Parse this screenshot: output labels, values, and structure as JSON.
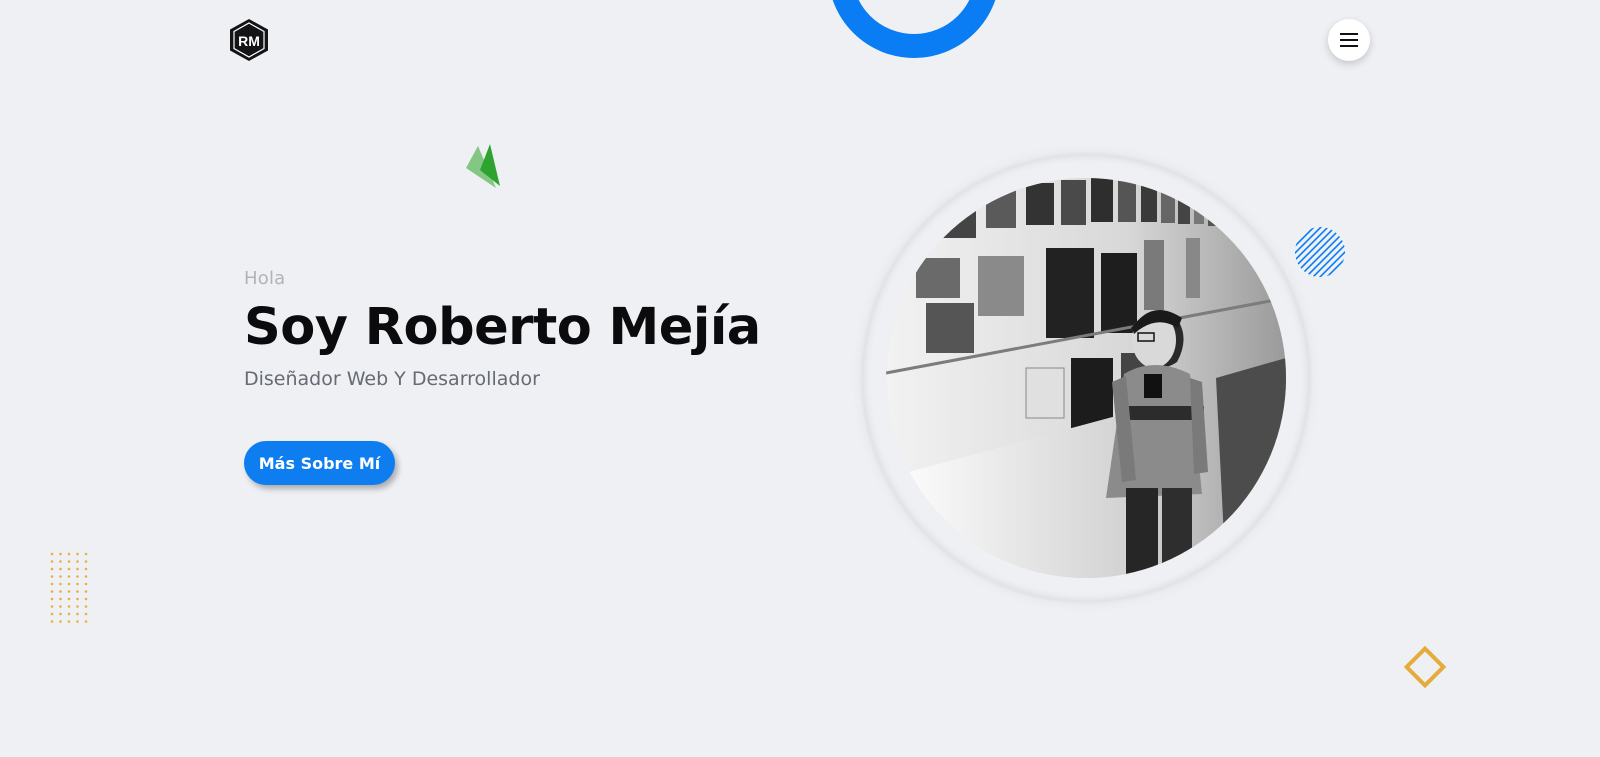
{
  "header": {
    "logo_text": "RM",
    "logo_icon": "rm-hexagon-logo",
    "menu_icon": "hamburger-icon"
  },
  "hero": {
    "greeting": "Hola",
    "name": "Soy Roberto Mejía",
    "role": "Diseñador Web Y Desarrollador",
    "cta_label": "Más Sobre Mí"
  },
  "photo": {
    "icon": "profile-photo",
    "style": "black-and-white"
  },
  "decorations": {
    "ring": "blue-ring",
    "triangle": "green-triangle",
    "stripes": "striped-circle",
    "dots": "dot-grid",
    "diamond": "diamond-outline"
  },
  "colors": {
    "background": "#eef0f4",
    "accent": "#0d7df0",
    "ring": "#0a7cf4",
    "triangle": "#2fa32f",
    "dots": "#e8b040",
    "diamond": "#e5ac3c",
    "text_dark": "#0b0b0d",
    "text_muted": "#b0b3b8"
  }
}
